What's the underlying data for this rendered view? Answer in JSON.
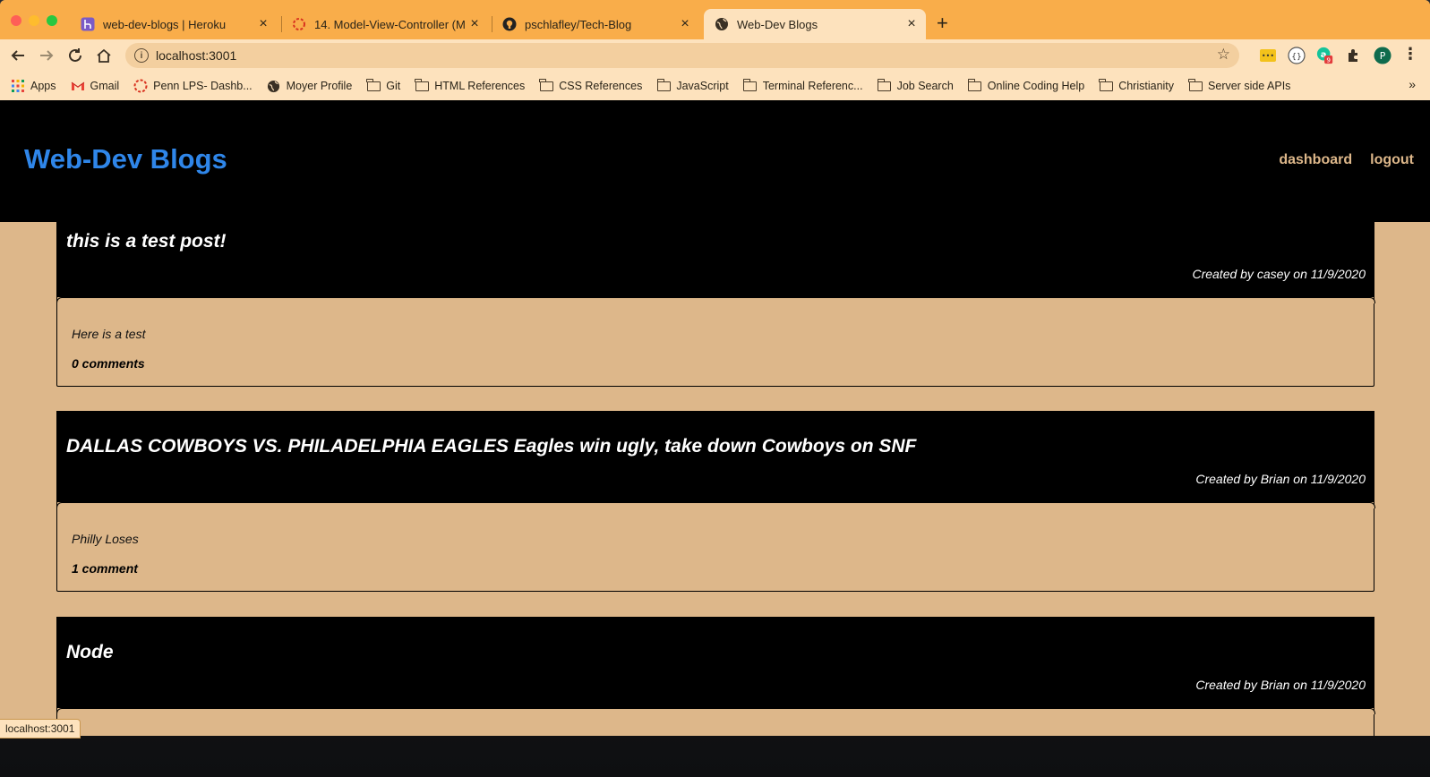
{
  "browser": {
    "tabs": [
      {
        "title": "web-dev-blogs | Heroku",
        "favicon": "heroku-icon"
      },
      {
        "title": "14. Model-View-Controller (MV",
        "favicon": "loading-icon"
      },
      {
        "title": "pschlafley/Tech-Blog",
        "favicon": "github-icon"
      },
      {
        "title": "Web-Dev Blogs",
        "favicon": "globe-icon",
        "active": true
      }
    ],
    "new_tab": "+",
    "close_glyph": "×",
    "url": "localhost:3001",
    "profile_initial": "P",
    "extension_badge": "9",
    "bookmarks": [
      {
        "label": "Apps",
        "icon": "apps-grid-icon"
      },
      {
        "label": "Gmail",
        "icon": "gmail-icon"
      },
      {
        "label": "Penn LPS- Dashb...",
        "icon": "penn-icon"
      },
      {
        "label": "Moyer Profile",
        "icon": "globe-icon"
      },
      {
        "label": "Git",
        "icon": "folder-icon"
      },
      {
        "label": "HTML References",
        "icon": "folder-icon"
      },
      {
        "label": "CSS References",
        "icon": "folder-icon"
      },
      {
        "label": "JavaScript",
        "icon": "folder-icon"
      },
      {
        "label": "Terminal Referenc...",
        "icon": "folder-icon"
      },
      {
        "label": "Job Search",
        "icon": "folder-icon"
      },
      {
        "label": "Online Coding Help",
        "icon": "folder-icon"
      },
      {
        "label": "Christianity",
        "icon": "folder-icon"
      },
      {
        "label": "Server side APIs",
        "icon": "folder-icon"
      }
    ],
    "bookmarks_overflow": "»",
    "status_url": "localhost:3001"
  },
  "site": {
    "title": "Web-Dev Blogs",
    "nav": {
      "dashboard": "dashboard",
      "logout": "logout"
    }
  },
  "posts": [
    {
      "title": "this is a test post!",
      "meta": "Created by casey on 11/9/2020",
      "content": "Here is a test",
      "comments": "0 comments"
    },
    {
      "title": "DALLAS COWBOYS VS. PHILADELPHIA EAGLES Eagles win ugly, take down Cowboys on SNF",
      "meta": "Created by Brian on 11/9/2020",
      "content": "Philly Loses",
      "comments": "1 comment"
    },
    {
      "title": "Node",
      "meta": "Created by Brian on 11/9/2020",
      "content": "",
      "comments": ""
    }
  ],
  "colors": {
    "tabstrip": "#f9ad4a",
    "toolbar": "#fde2bd",
    "page_bg": "#ddb78a",
    "site_title": "#2f86e9",
    "nav_link": "#ddb78a"
  }
}
